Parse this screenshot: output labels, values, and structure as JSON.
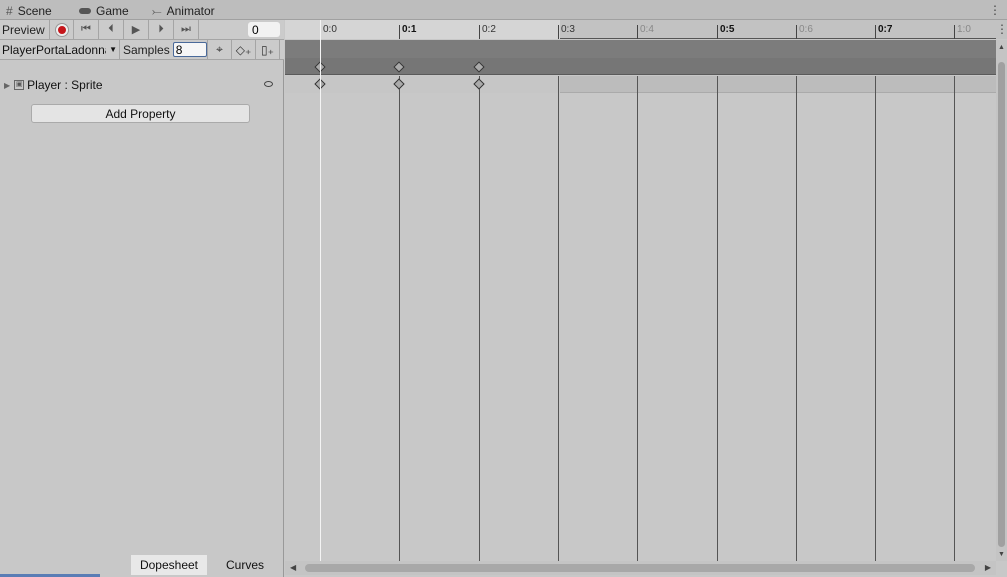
{
  "tabs": [
    {
      "label": "Scene",
      "icon": "grid-icon"
    },
    {
      "label": "Game",
      "icon": "gamepad-icon"
    },
    {
      "label": "Animator",
      "icon": "animator-icon"
    }
  ],
  "toolbar": {
    "preview_label": "Preview",
    "current_frame": "0",
    "clip_name": "PlayerPortaLadonna",
    "samples_label": "Samples",
    "samples_value": "8"
  },
  "properties": [
    {
      "label": "Player : Sprite"
    }
  ],
  "add_property_label": "Add Property",
  "bottom_tabs": {
    "dopesheet": "Dopesheet",
    "curves": "Curves"
  },
  "timeline": {
    "ticks": [
      "0:0",
      "0:1",
      "0:2",
      "0:3",
      "0:4",
      "0:5",
      "0:6",
      "0:7",
      "1:0"
    ],
    "keyframes_at": [
      "0:0",
      "0:1",
      "0:2"
    ],
    "playhead_at": "0:0"
  }
}
